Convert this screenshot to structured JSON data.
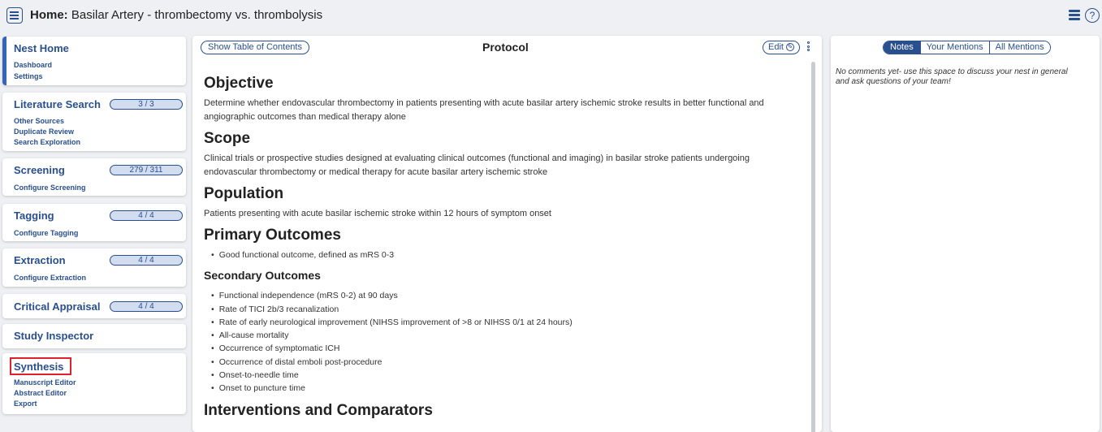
{
  "header": {
    "title_prefix": "Home:",
    "title_text": "Basilar Artery - thrombectomy vs. thrombolysis",
    "help_glyph": "?"
  },
  "sidebar": {
    "nest_home": {
      "title": "Nest Home",
      "links": [
        "Dashboard",
        "Settings"
      ]
    },
    "literature_search": {
      "title": "Literature Search",
      "count": "3 / 3",
      "links": [
        "Other Sources",
        "Duplicate Review",
        "Search Exploration"
      ]
    },
    "screening": {
      "title": "Screening",
      "count": "279 / 311",
      "links": [
        "Configure Screening"
      ]
    },
    "tagging": {
      "title": "Tagging",
      "count": "4 / 4",
      "links": [
        "Configure Tagging"
      ]
    },
    "extraction": {
      "title": "Extraction",
      "count": "4 / 4",
      "links": [
        "Configure Extraction"
      ]
    },
    "critical_appraisal": {
      "title": "Critical Appraisal",
      "count": "4 / 4"
    },
    "study_inspector": {
      "title": "Study Inspector"
    },
    "synthesis": {
      "title": "Synthesis",
      "links": [
        "Manuscript Editor",
        "Abstract Editor",
        "Export"
      ]
    }
  },
  "protocol": {
    "toc_label": "Show Table of Contents",
    "title": "Protocol",
    "edit_label": "Edit",
    "objective": {
      "heading": "Objective",
      "text": "Determine whether endovascular thrombectomy in patients presenting with acute basilar artery ischemic stroke results in better functional and angiographic outcomes than medical therapy alone"
    },
    "scope": {
      "heading": "Scope",
      "text": "Clinical trials or prospective studies designed at evaluating clinical outcomes (functional and imaging) in basilar stroke patients undergoing endovascular thrombectomy or medical therapy for acute basilar artery ischemic stroke"
    },
    "population": {
      "heading": "Population",
      "text": "Patients presenting with acute basilar ischemic stroke within 12 hours of symptom onset"
    },
    "primary_outcomes": {
      "heading": "Primary Outcomes",
      "items": [
        "Good functional outcome, defined as mRS 0-3"
      ]
    },
    "secondary_outcomes": {
      "heading": "Secondary Outcomes",
      "items": [
        "Functional independence (mRS 0-2) at 90 days",
        "Rate of TICI 2b/3 recanalization",
        "Rate of early neurological improvement (NIHSS improvement of >8 or NIHSS 0/1 at 24 hours)",
        "All-cause mortality",
        "Occurrence of symptomatic ICH",
        "Occurrence of distal emboli post-procedure",
        "Onset-to-needle time",
        "Onset to puncture time"
      ]
    },
    "next_heading": "Interventions and Comparators"
  },
  "notes": {
    "tabs": [
      "Notes",
      "Your Mentions",
      "All Mentions"
    ],
    "active_tab": "Notes",
    "empty_text": "No comments yet- use this space to discuss your nest in general and ask questions of your team!"
  },
  "colors": {
    "accent": "#2a4f8e",
    "highlight": "#e0202a",
    "pill_fill": "#d3ddf0"
  }
}
